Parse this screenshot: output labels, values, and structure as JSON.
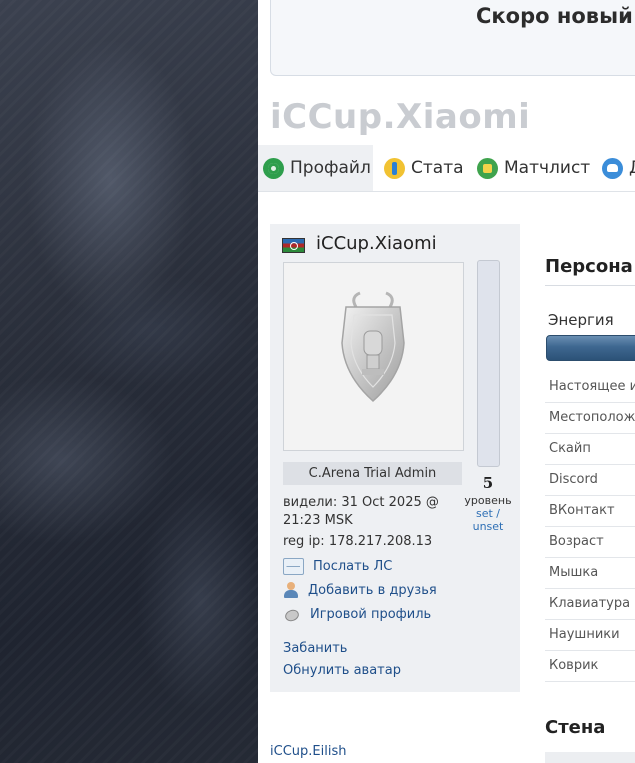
{
  "announcement": {
    "text": "Скоро новый с"
  },
  "site_title": "iCCup.Xiaomi",
  "tabs": [
    {
      "label": "Профайл",
      "icon": "profile-icon",
      "active": true
    },
    {
      "label": "Стата",
      "icon": "stats-icon",
      "active": false
    },
    {
      "label": "Матчлист",
      "icon": "matches-icon",
      "active": false
    },
    {
      "label": "Д",
      "icon": "friends-icon",
      "active": false
    }
  ],
  "profile": {
    "name": "iCCup.Xiaomi",
    "flag": "flag-icon",
    "avatar": "trophy-shield-emblem",
    "level_number": "5",
    "level_label": "уровень",
    "level_set": "set /",
    "level_unset": "unset",
    "role": "C.Arena Trial Admin",
    "seen_text": "видели: 31 Oct 2025 @ 21:23 MSK",
    "reg_ip_text": "reg ip: 178.217.208.13",
    "actions": [
      {
        "label": "Послать ЛС",
        "icon": "mail-icon"
      },
      {
        "label": "Добавить в друзья",
        "icon": "add-friend-icon"
      },
      {
        "label": "Игровой профиль",
        "icon": "game-profile-icon"
      }
    ],
    "admin_links": [
      "Забанить",
      "Обнулить аватар"
    ]
  },
  "personal": {
    "title": "Персона",
    "energy_label": "Энергия",
    "fields": [
      "Настоящее и",
      "Местоположе",
      "Скайп",
      "Discord",
      "ВКонтакт",
      "Возраст",
      "Мышка",
      "Клавиатура",
      "Наушники",
      "Коврик"
    ]
  },
  "wall": {
    "title": "Стена"
  },
  "bottom_link": "iCCup.Eilish",
  "colors": {
    "link": "#1f4f8a",
    "card_bg": "#eef0f3",
    "title_gray": "#c9ccd1",
    "energy": "#3e6790"
  }
}
